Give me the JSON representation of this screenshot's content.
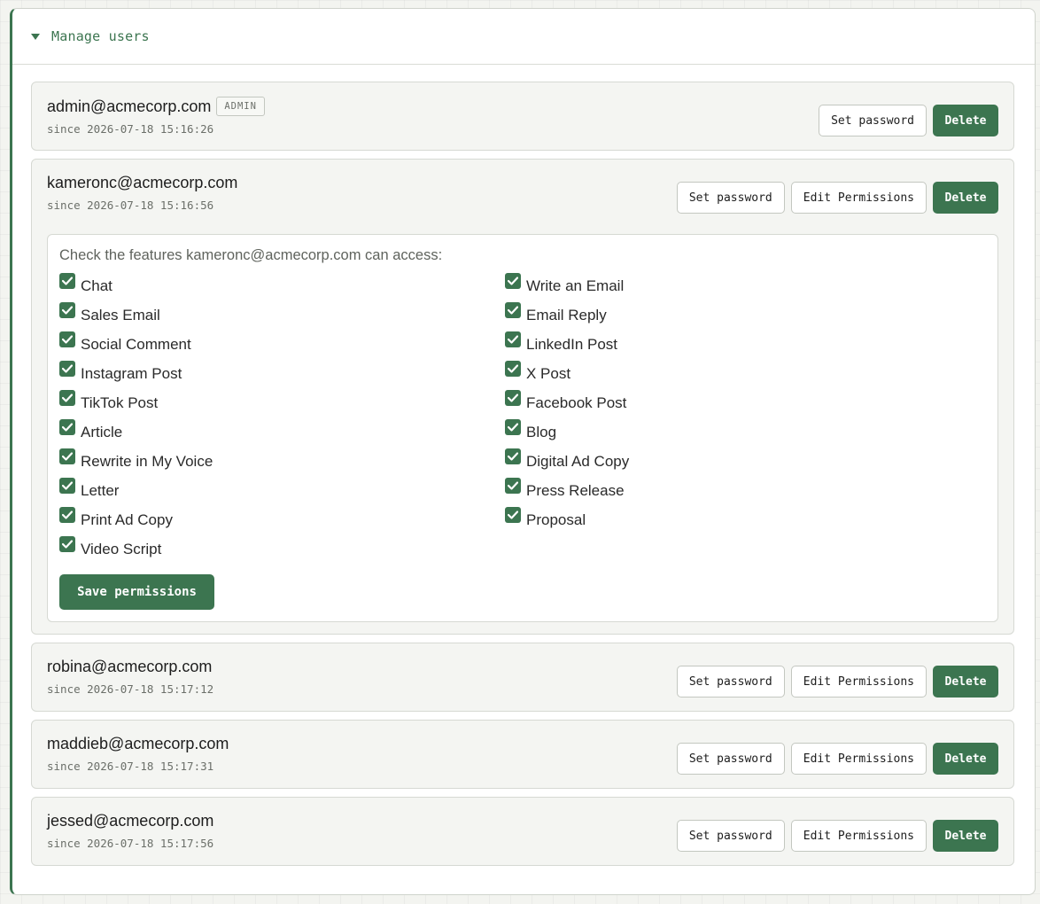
{
  "panel": {
    "title": "Manage users"
  },
  "labels": {
    "set_password": "Set password",
    "edit_permissions": "Edit Permissions",
    "delete": "Delete",
    "save_permissions": "Save permissions"
  },
  "users": [
    {
      "email": "admin@acmecorp.com",
      "badge": "ADMIN",
      "since": "since 2026-07-18 15:16:26"
    },
    {
      "email": "kameronc@acmecorp.com",
      "since": "since 2026-07-18 15:16:56"
    },
    {
      "email": "robina@acmecorp.com",
      "since": "since 2026-07-18 15:17:12"
    },
    {
      "email": "maddieb@acmecorp.com",
      "since": "since 2026-07-18 15:17:31"
    },
    {
      "email": "jessed@acmecorp.com",
      "since": "since 2026-07-18 15:17:56"
    }
  ],
  "permissions": {
    "heading": "Check the features kameronc@acmecorp.com can access:",
    "items": [
      {
        "label": "Chat",
        "checked": true
      },
      {
        "label": "Write an Email",
        "checked": true
      },
      {
        "label": "Sales Email",
        "checked": true
      },
      {
        "label": "Email Reply",
        "checked": true
      },
      {
        "label": "Social Comment",
        "checked": true
      },
      {
        "label": "LinkedIn Post",
        "checked": true
      },
      {
        "label": "Instagram Post",
        "checked": true
      },
      {
        "label": "X Post",
        "checked": true
      },
      {
        "label": "TikTok Post",
        "checked": true
      },
      {
        "label": "Facebook Post",
        "checked": true
      },
      {
        "label": "Article",
        "checked": true
      },
      {
        "label": "Blog",
        "checked": true
      },
      {
        "label": "Rewrite in My Voice",
        "checked": true
      },
      {
        "label": "Digital Ad Copy",
        "checked": true
      },
      {
        "label": "Letter",
        "checked": true
      },
      {
        "label": "Press Release",
        "checked": true
      },
      {
        "label": "Print Ad Copy",
        "checked": true
      },
      {
        "label": "Proposal",
        "checked": true
      },
      {
        "label": "Video Script",
        "checked": true
      }
    ]
  },
  "colors": {
    "accent": "#3c7550",
    "card_bg": "#f4f5f2",
    "muted_text": "#6b6f69"
  }
}
